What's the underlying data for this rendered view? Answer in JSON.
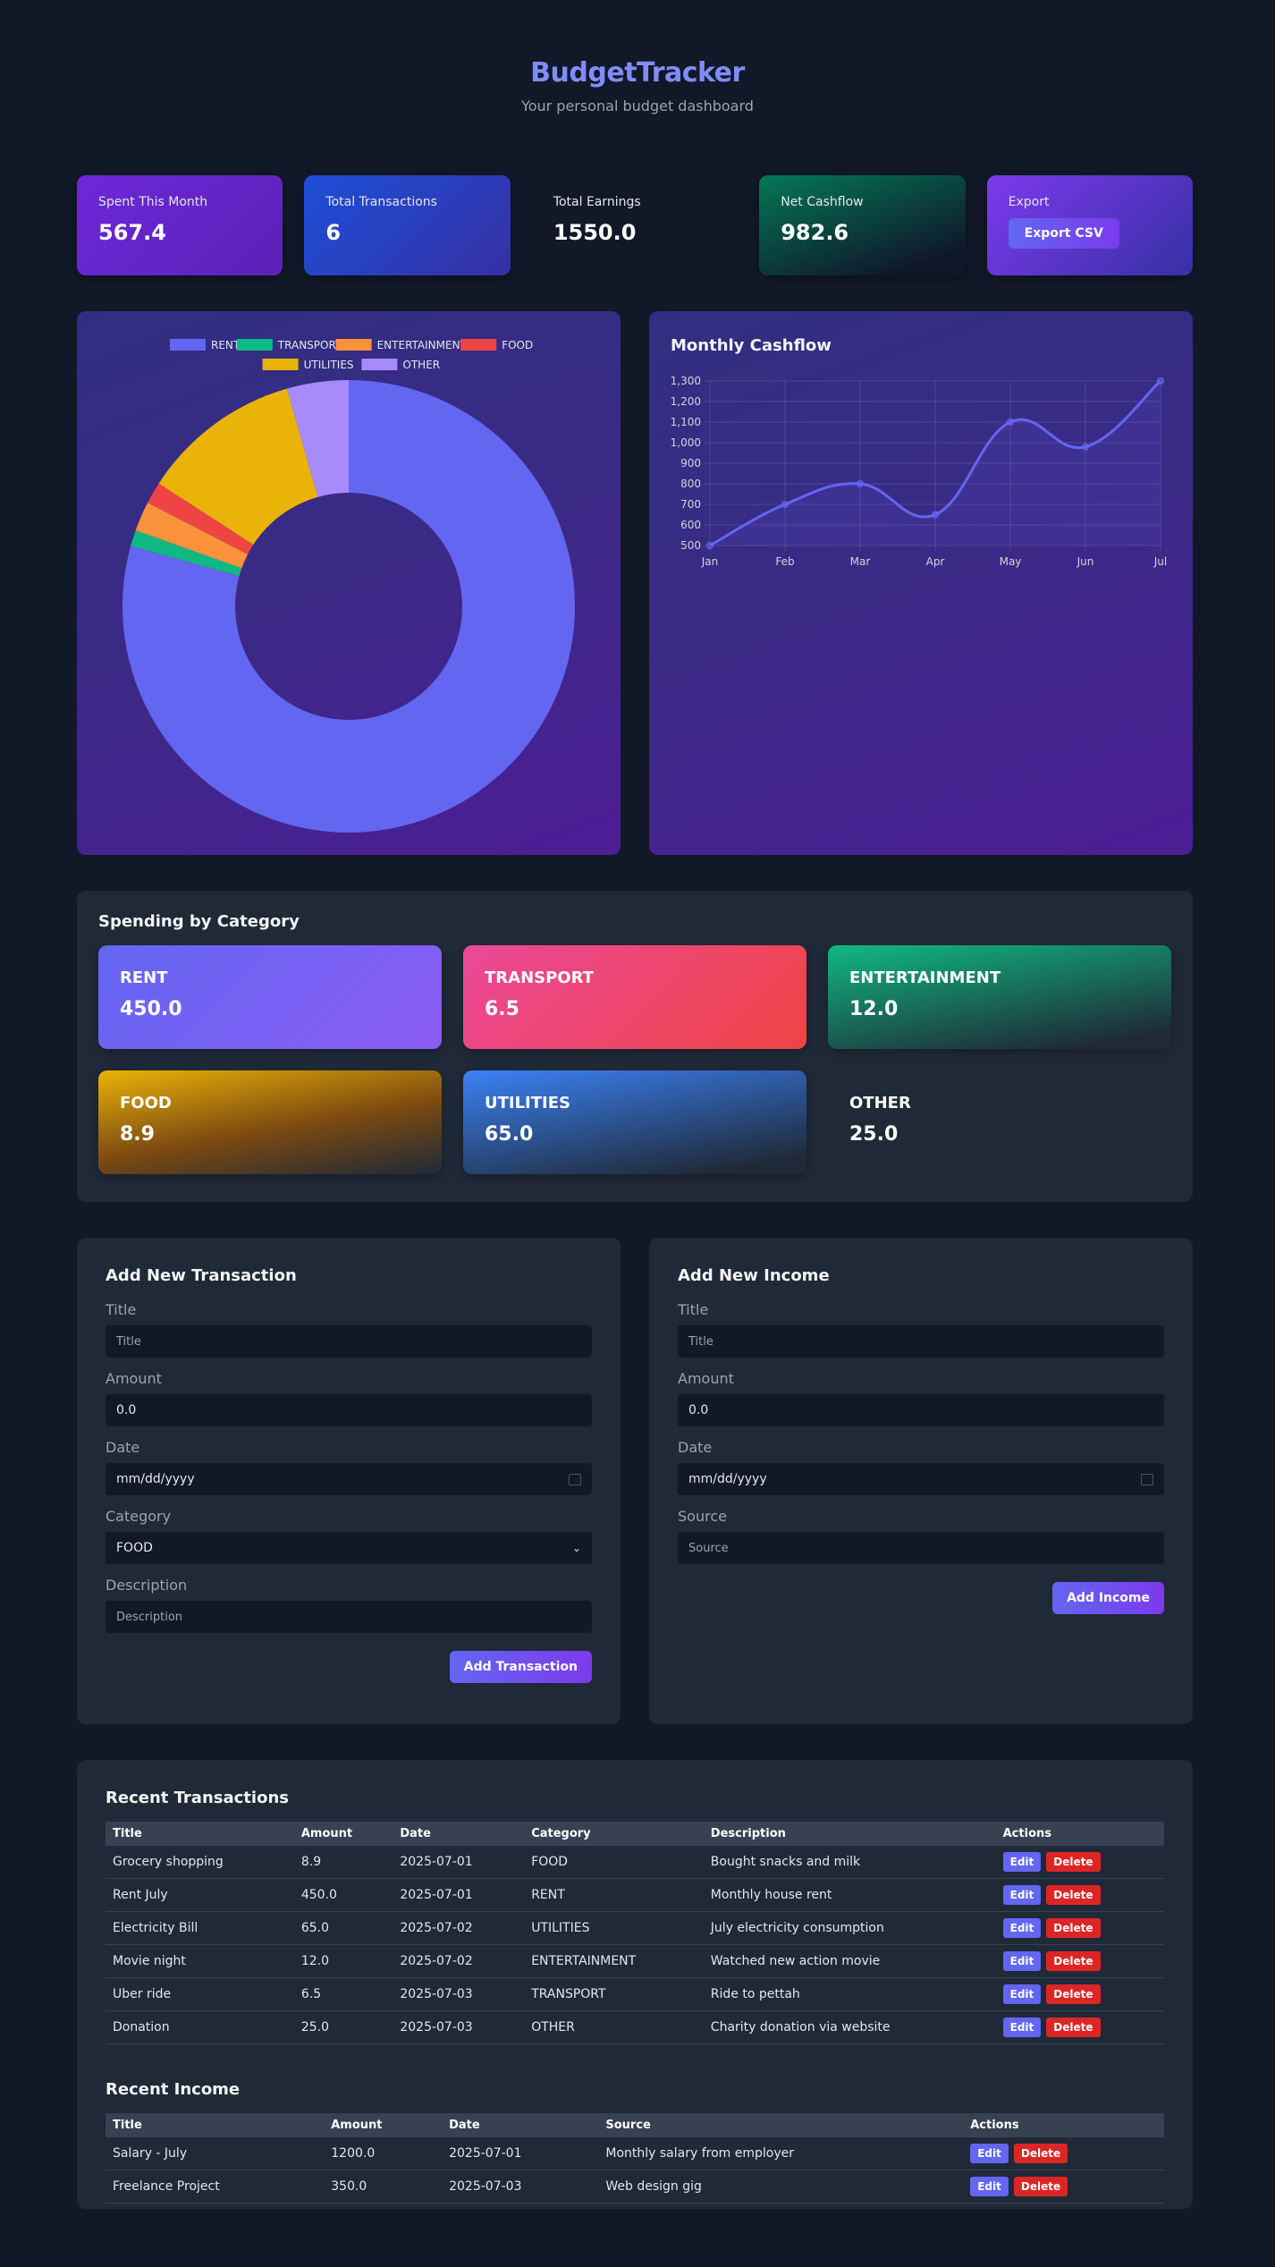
{
  "header": {
    "title": "BudgetTracker",
    "subtitle": "Your personal budget dashboard"
  },
  "stats": [
    {
      "label": "Spent This Month",
      "value": "567.4"
    },
    {
      "label": "Total Transactions",
      "value": "6"
    },
    {
      "label": "Total Earnings",
      "value": "1550.0"
    },
    {
      "label": "Net Cashflow",
      "value": "982.6"
    },
    {
      "label": "Export",
      "button": "Export CSV"
    }
  ],
  "colors": {
    "RENT": "#6366f1",
    "TRANSPORT": "#10b981",
    "ENTERTAINMENT": "#fb923c",
    "FOOD": "#ef4444",
    "UTILITIES": "#eab308",
    "OTHER": "#a78bfa",
    "line": "#6366f1"
  },
  "chart_data": [
    {
      "type": "pie",
      "title": "",
      "legend_position": "top",
      "categories": [
        "RENT",
        "TRANSPORT",
        "ENTERTAINMENT",
        "FOOD",
        "UTILITIES",
        "OTHER"
      ],
      "values": [
        450.0,
        6.5,
        12.0,
        8.9,
        65.0,
        25.0
      ]
    },
    {
      "type": "line",
      "title": "Monthly Cashflow",
      "categories": [
        "Jan",
        "Feb",
        "Mar",
        "Apr",
        "May",
        "Jun",
        "Jul"
      ],
      "values": [
        500,
        700,
        800,
        650,
        1100,
        980,
        1300
      ],
      "ylim": [
        500,
        1300
      ],
      "yticks": [
        "1,300",
        "1,200",
        "1,100",
        "1,000",
        "900",
        "800",
        "700",
        "600",
        "500"
      ],
      "grid": true
    }
  ],
  "categories_section": {
    "title": "Spending by Category",
    "items": [
      {
        "name": "RENT",
        "amount": "450.0"
      },
      {
        "name": "TRANSPORT",
        "amount": "6.5"
      },
      {
        "name": "ENTERTAINMENT",
        "amount": "12.0"
      },
      {
        "name": "FOOD",
        "amount": "8.9"
      },
      {
        "name": "UTILITIES",
        "amount": "65.0"
      },
      {
        "name": "OTHER",
        "amount": "25.0"
      }
    ]
  },
  "transaction_form": {
    "title": "Add New Transaction",
    "title_label": "Title",
    "title_placeholder": "Title",
    "amount_label": "Amount",
    "amount_value": "0.0",
    "date_label": "Date",
    "date_value": "mm/dd/yyyy",
    "category_label": "Category",
    "category_value": "FOOD",
    "description_label": "Description",
    "description_placeholder": "Description",
    "submit": "Add Transaction"
  },
  "income_form": {
    "title": "Add New Income",
    "title_label": "Title",
    "title_placeholder": "Title",
    "amount_label": "Amount",
    "amount_value": "0.0",
    "date_label": "Date",
    "date_value": "mm/dd/yyyy",
    "source_label": "Source",
    "source_placeholder": "Source",
    "submit": "Add Income"
  },
  "transactions": {
    "title": "Recent Transactions",
    "headers": [
      "Title",
      "Amount",
      "Date",
      "Category",
      "Description",
      "Actions"
    ],
    "rows": [
      [
        "Grocery shopping",
        "8.9",
        "2025-07-01",
        "FOOD",
        "Bought snacks and milk"
      ],
      [
        "Rent July",
        "450.0",
        "2025-07-01",
        "RENT",
        "Monthly house rent"
      ],
      [
        "Electricity Bill",
        "65.0",
        "2025-07-02",
        "UTILITIES",
        "July electricity consumption"
      ],
      [
        "Movie night",
        "12.0",
        "2025-07-02",
        "ENTERTAINMENT",
        "Watched new action movie"
      ],
      [
        "Uber ride",
        "6.5",
        "2025-07-03",
        "TRANSPORT",
        "Ride to pettah"
      ],
      [
        "Donation",
        "25.0",
        "2025-07-03",
        "OTHER",
        "Charity donation via website"
      ]
    ],
    "edit": "Edit",
    "delete": "Delete"
  },
  "income": {
    "title": "Recent Income",
    "headers": [
      "Title",
      "Amount",
      "Date",
      "Source",
      "Actions"
    ],
    "rows": [
      [
        "Salary - July",
        "1200.0",
        "2025-07-01",
        "Monthly salary from employer"
      ],
      [
        "Freelance Project",
        "350.0",
        "2025-07-03",
        "Web design gig"
      ]
    ],
    "edit": "Edit",
    "delete": "Delete"
  }
}
